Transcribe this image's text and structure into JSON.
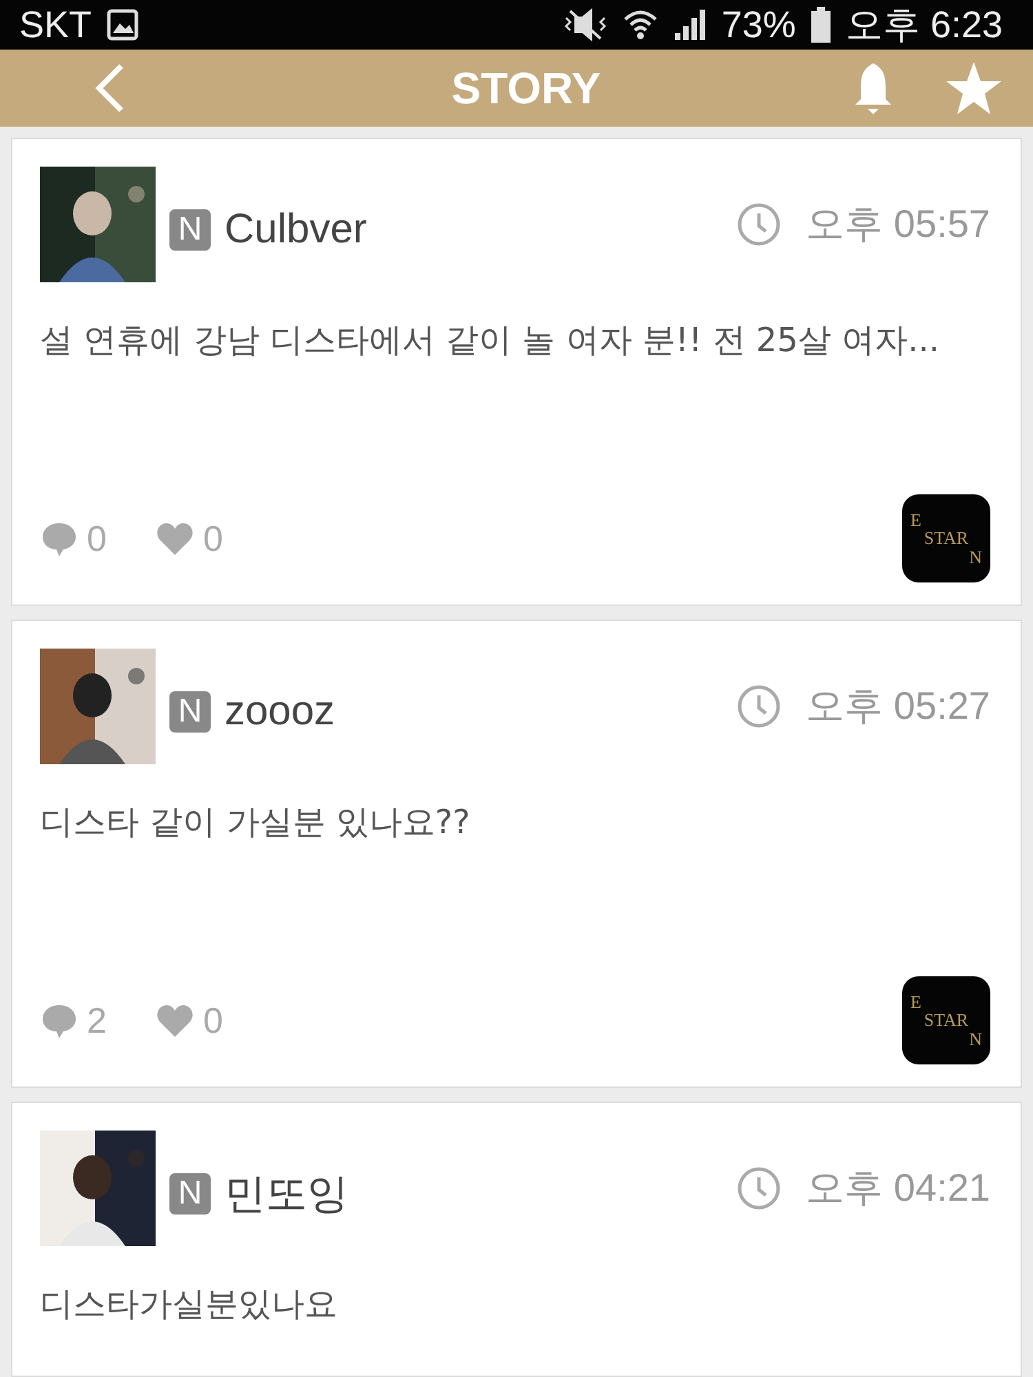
{
  "status_bar": {
    "carrier": "SKT",
    "battery": "73%",
    "time": "오후 6:23"
  },
  "header": {
    "title": "STORY"
  },
  "posts": [
    {
      "badge": "N",
      "author": "Culbver",
      "time": "오후 05:57",
      "text": "설 연휴에 강남 디스타에서 같이 놀 여자 분!! 전 25살 여자...",
      "comments": "0",
      "likes": "0",
      "app_logo": [
        "E",
        "STAR",
        "N"
      ]
    },
    {
      "badge": "N",
      "author": "zoooz",
      "time": "오후 05:27",
      "text": "디스타 같이 가실분 있나요??",
      "comments": "2",
      "likes": "0",
      "app_logo": [
        "E",
        "STAR",
        "N"
      ]
    },
    {
      "badge": "N",
      "author": "민또잉",
      "time": "오후 04:21",
      "text": "디스타가실분있나요"
    }
  ]
}
